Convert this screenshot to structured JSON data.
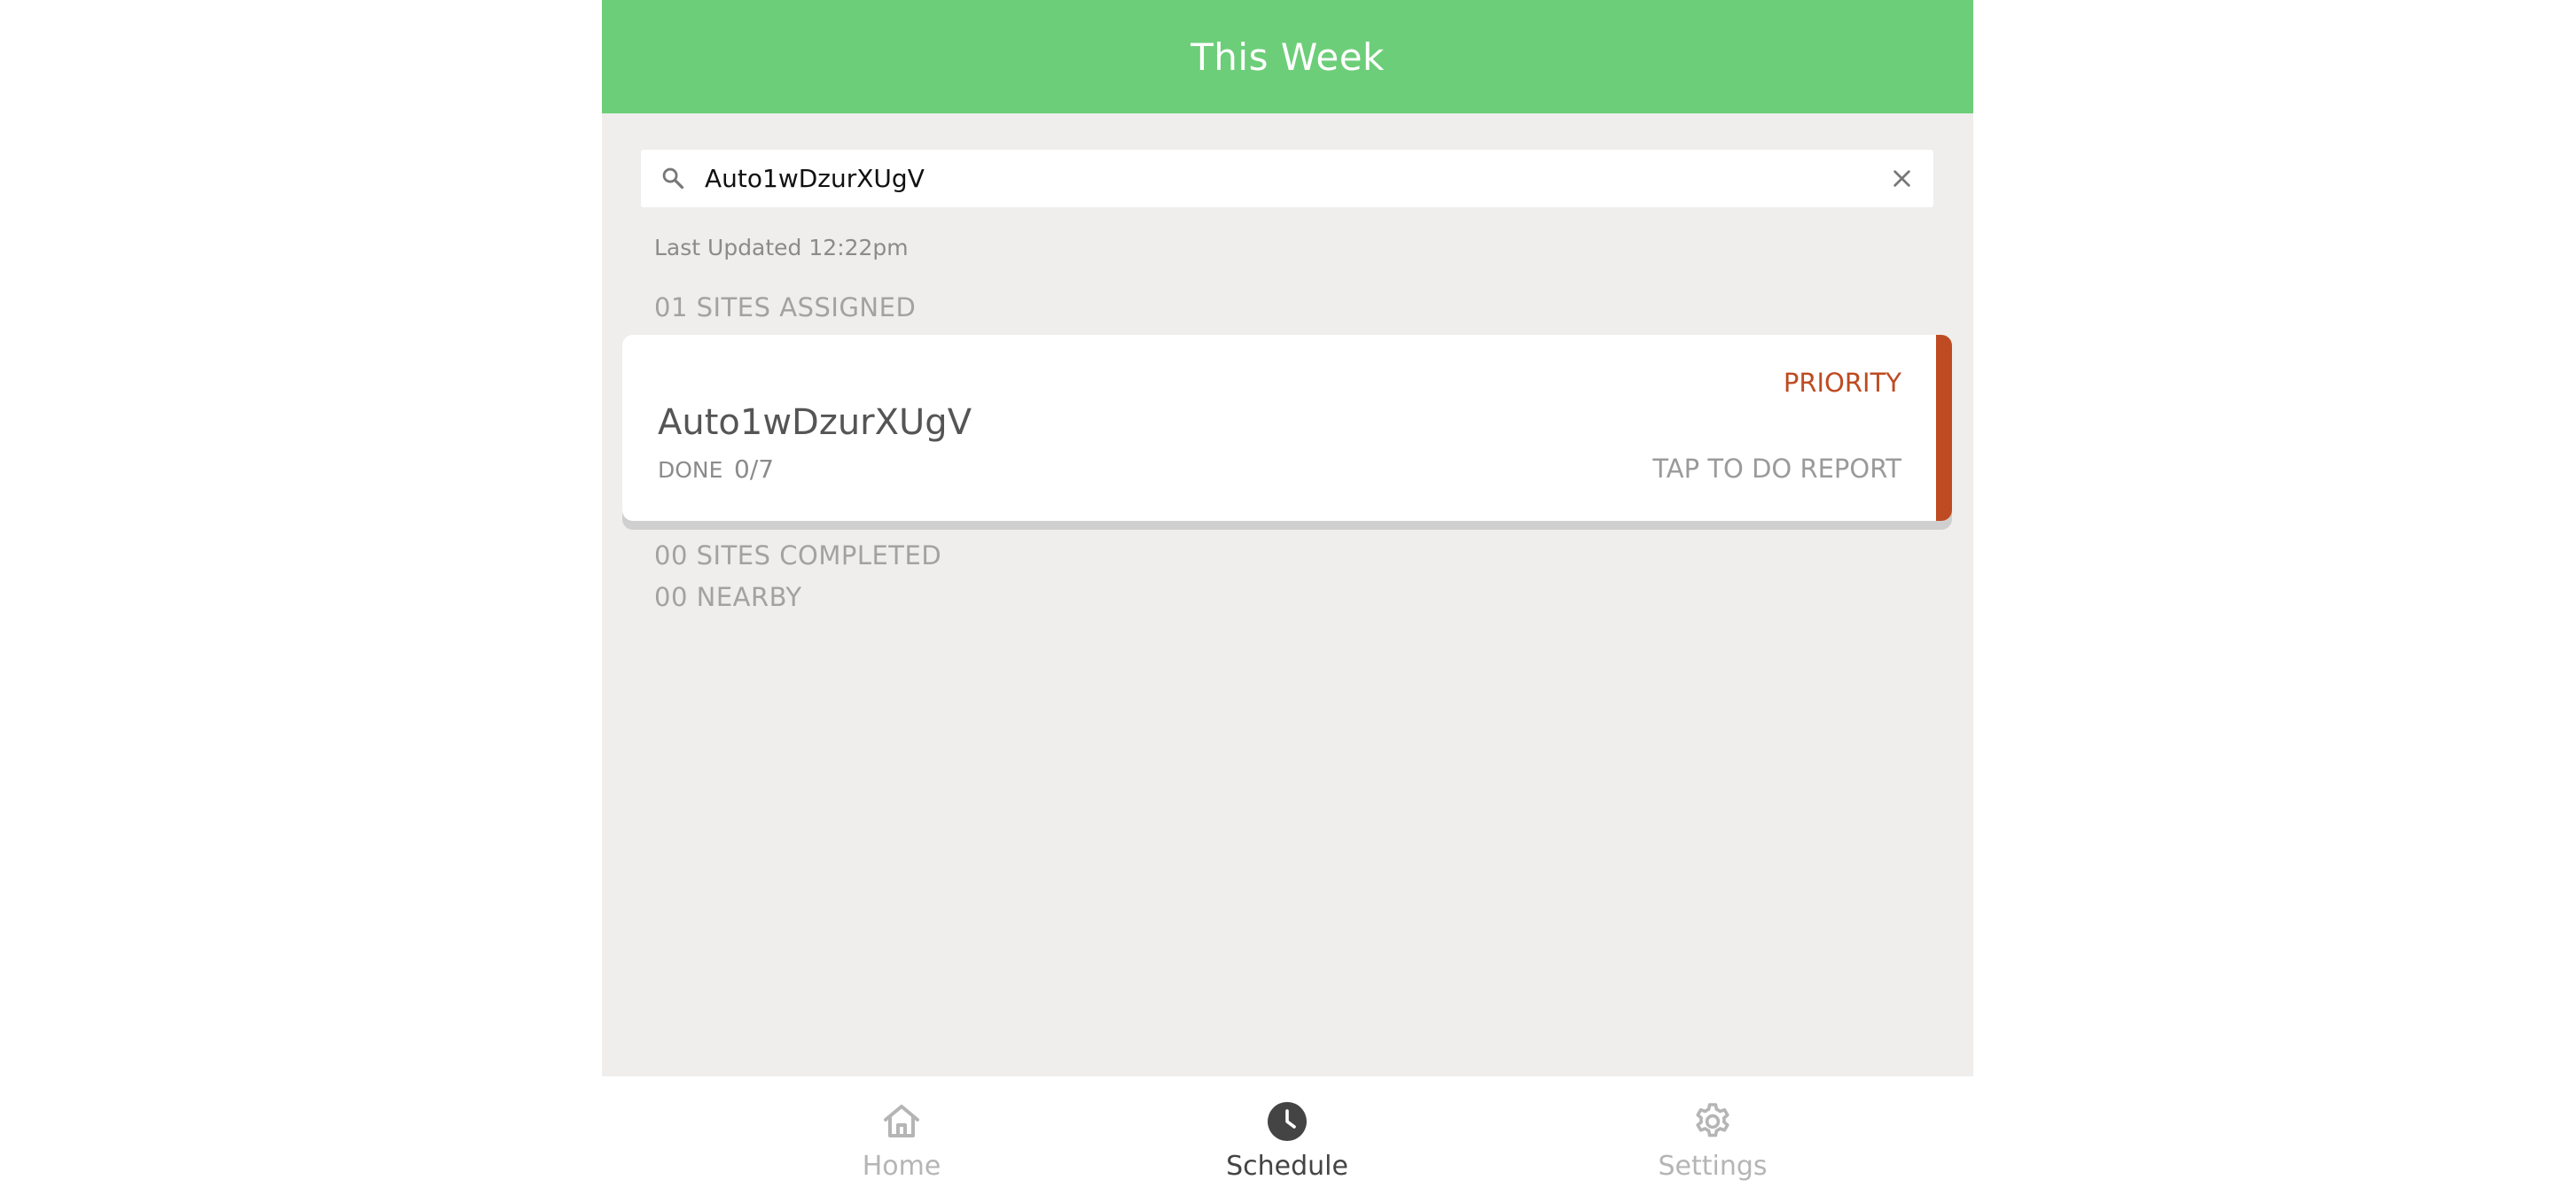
{
  "header": {
    "title": "This Week"
  },
  "search": {
    "value": "Auto1wDzurXUgV"
  },
  "last_updated": "Last Updated 12:22pm",
  "sections": {
    "assigned": "01 SITES ASSIGNED",
    "completed": "00 SITES COMPLETED",
    "nearby": "00 NEARBY"
  },
  "site_card": {
    "badge": "PRIORITY",
    "name": "Auto1wDzurXUgV",
    "done_label": "DONE",
    "done_value": "0/7",
    "action": "TAP TO DO REPORT"
  },
  "nav": {
    "home": "Home",
    "schedule": "Schedule",
    "settings": "Settings",
    "active": "schedule"
  },
  "colors": {
    "header": "#6dce79",
    "background": "#efeeec",
    "priority": "#be4b21"
  }
}
